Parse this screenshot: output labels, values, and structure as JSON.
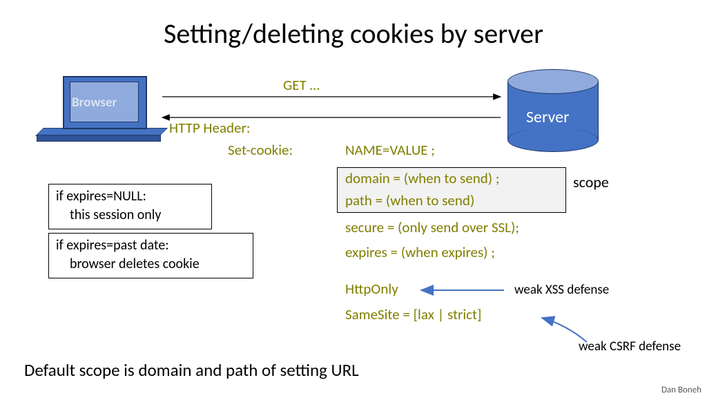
{
  "title": "Setting/deleting cookies by server",
  "browser_label": "Browser",
  "server_label": "Server",
  "request_label": "GET …",
  "response_header_label": "HTTP Header:",
  "set_cookie_label": "Set-cookie:",
  "name_value": "NAME=VALUE ;",
  "attrs": {
    "domain": "domain = (when to send) ;",
    "path": "path = (when to send)",
    "secure": "secure = (only send over SSL);",
    "expires": "expires = (when expires) ;",
    "httponly": "HttpOnly",
    "samesite": "SameSite = [lax | strict]"
  },
  "scope_label": "scope",
  "notes": {
    "null_line1": "if expires=NULL:",
    "null_line2": "this session only",
    "past_line1": "if expires=past date:",
    "past_line2": "browser deletes cookie"
  },
  "annotations": {
    "xss": "weak XSS defense",
    "csrf": "weak CSRF defense"
  },
  "footer": "Default scope is domain and path of setting URL",
  "author": "Dan Boneh"
}
